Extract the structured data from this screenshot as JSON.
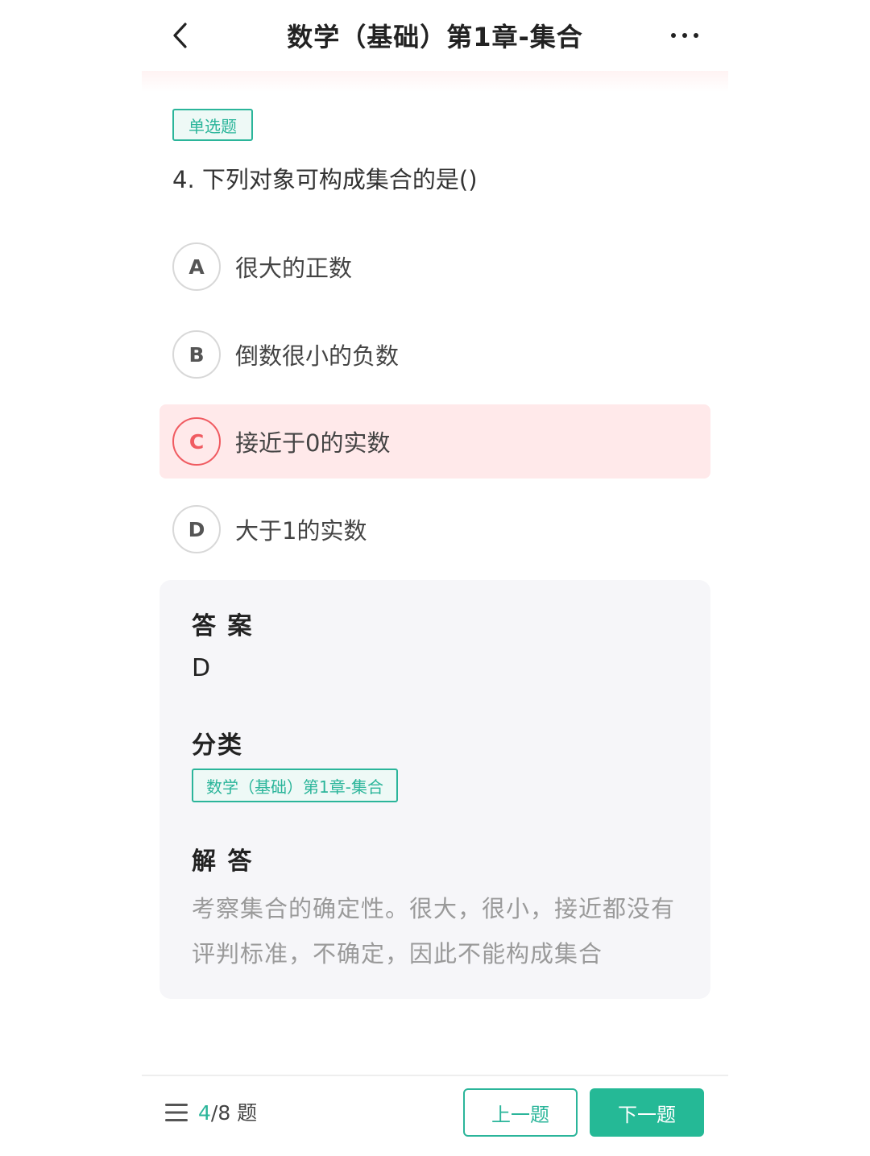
{
  "header": {
    "title": "数学（基础）第1章-集合",
    "back_icon": "chevron-left-icon",
    "more_icon": "more-dots-icon"
  },
  "question": {
    "type_label": "单选题",
    "text": "4. 下列对象可构成集合的是()",
    "options": [
      {
        "letter": "A",
        "text": "很大的正数"
      },
      {
        "letter": "B",
        "text": "倒数很小的负数"
      },
      {
        "letter": "C",
        "text": "接近于0的实数"
      },
      {
        "letter": "D",
        "text": "大于1的实数"
      }
    ],
    "selected_letter": "C"
  },
  "answer_panel": {
    "answer_title": "答 案",
    "answer_value": "D",
    "category_title": "分类",
    "category_tag": "数学（基础）第1章-集合",
    "explanation_title": "解 答",
    "explanation_text": "考察集合的确定性。很大，很小，接近都没有评判标准，不确定，因此不能构成集合"
  },
  "footer": {
    "menu_icon": "menu-icon",
    "current": "4",
    "total_text": "/8 题",
    "prev_label": "上一题",
    "next_label": "下一题"
  },
  "colors": {
    "accent": "#2bb59a",
    "wrong": "#f05b61",
    "wrong_bg": "#ffe9ea",
    "panel_bg": "#f6f6f9"
  }
}
